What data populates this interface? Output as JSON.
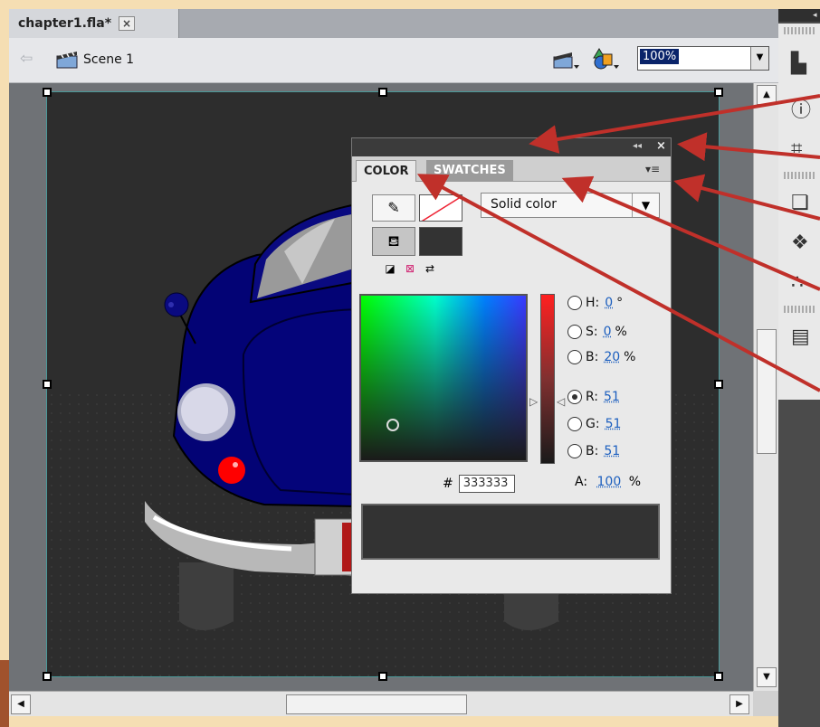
{
  "document": {
    "tab_title": "chapter1.fla*",
    "tab_close": "×",
    "scene": "Scene 1",
    "zoom": "100%"
  },
  "color_panel": {
    "tabs": [
      "COLOR",
      "SWATCHES"
    ],
    "active_tab": "COLOR",
    "collapse_glyph": "◂◂",
    "close_glyph": "×",
    "menu_glyph": "▾≡",
    "fill_type": "Solid color",
    "fields": [
      {
        "label": "H:",
        "value": "0",
        "unit": "°",
        "selected": false
      },
      {
        "label": "S:",
        "value": "0",
        "unit": "%",
        "selected": false
      },
      {
        "label": "B:",
        "value": "20",
        "unit": "%",
        "selected": false
      },
      {
        "label": "R:",
        "value": "51",
        "unit": "",
        "selected": true
      },
      {
        "label": "G:",
        "value": "51",
        "unit": "",
        "selected": false
      },
      {
        "label": "B:",
        "value": "51",
        "unit": "",
        "selected": false
      }
    ],
    "hex_label": "#",
    "hex_value": "333333",
    "alpha_label": "A:",
    "alpha_value": "100",
    "alpha_unit": "%",
    "fill_color": "#333333",
    "stroke_color": "none"
  },
  "colors": {
    "stage_bg": "#2d2d2d",
    "car_body": "#000080",
    "headlight": "#d8d8e8",
    "tail_light": "#ff0000",
    "annotation_arrow": "#c0302a",
    "page_bg": "#f5deb3"
  },
  "icons": {
    "back": "arrow-left-icon",
    "scene": "clapperboard-icon",
    "edit_scene": "edit-scene-icon",
    "edit_symbol": "edit-symbol-icon",
    "stroke_tool": "pencil-icon",
    "fill_tool": "paint-bucket-icon",
    "dock": [
      "align-icon",
      "info-icon",
      "transform-icon",
      "actions-icon",
      "components-icon",
      "motion-presets-icon",
      "library-icon"
    ]
  }
}
